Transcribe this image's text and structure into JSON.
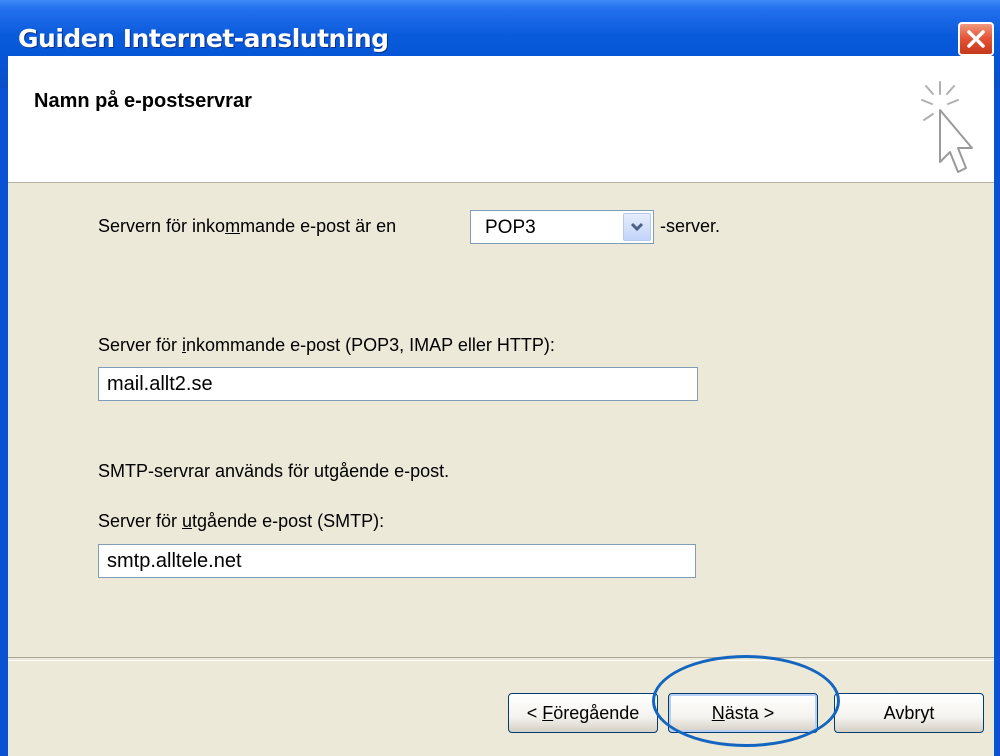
{
  "window": {
    "title": "Guiden Internet-anslutning"
  },
  "header": {
    "title": "Namn på e-postservrar"
  },
  "incoming_type": {
    "label_pre": "Servern för inko",
    "label_underlined": "m",
    "label_post": "mande e-post är en",
    "selected": "POP3",
    "suffix": "-server."
  },
  "incoming_server": {
    "label_pre": "Server för ",
    "label_underlined": "i",
    "label_post": "nkommande e-post (POP3, IMAP eller HTTP):",
    "value": "mail.allt2.se"
  },
  "smtp_info": "SMTP-servrar används för utgående e-post.",
  "outgoing_server": {
    "label_pre": "Server för ",
    "label_underlined": "u",
    "label_post": "tgående e-post (SMTP):",
    "value": "smtp.alltele.net"
  },
  "buttons": {
    "back_pre": "< ",
    "back_underlined": "F",
    "back_post": "öregående",
    "next_underlined": "N",
    "next_post": "ästa >",
    "cancel": "Avbryt"
  },
  "icons": {
    "close": "close-icon",
    "wizard": "wizard-cursor-icon",
    "dropdown": "chevron-down-icon"
  },
  "colors": {
    "titlebar": "#0a5bdc",
    "dialog_bg": "#ece9d8",
    "highlight": "#1465c0"
  }
}
